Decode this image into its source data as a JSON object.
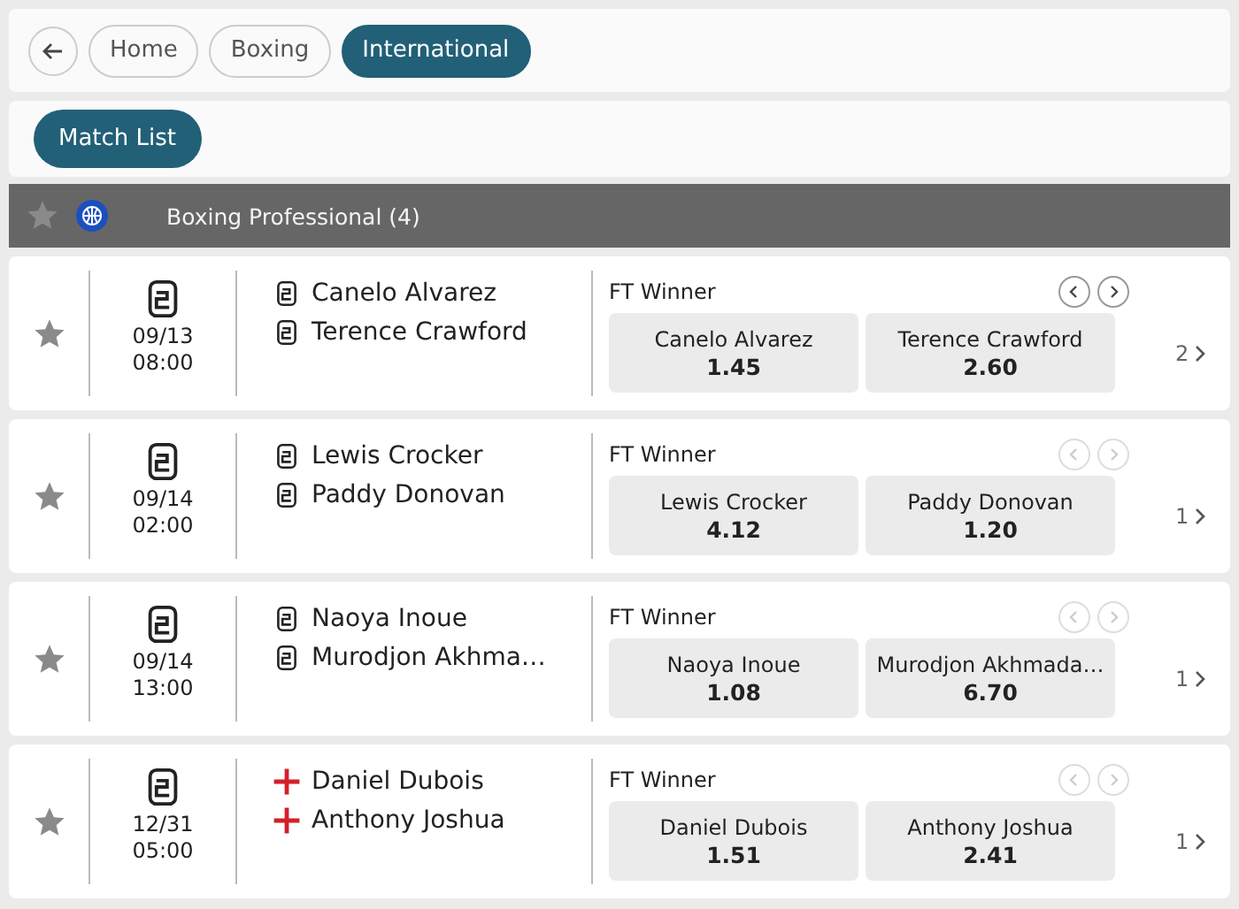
{
  "breadcrumbs": [
    {
      "label": "Home",
      "selected": false
    },
    {
      "label": "Boxing",
      "selected": false
    },
    {
      "label": "International",
      "selected": true
    }
  ],
  "match_list_button": "Match List",
  "league": {
    "name": "Boxing Professional (4)",
    "favorite": false
  },
  "matches": [
    {
      "kind": "belt",
      "favorite": false,
      "date": "09/13",
      "time": "08:00",
      "fighters": [
        "Canelo Alvarez",
        "Terence Crawford"
      ],
      "market": "FT Winner",
      "nav_enabled": true,
      "odds": [
        {
          "name": "Canelo Alvarez",
          "price": "1.45"
        },
        {
          "name": "Terence Crawford",
          "price": "2.60"
        }
      ],
      "more": "2"
    },
    {
      "kind": "belt",
      "favorite": false,
      "date": "09/14",
      "time": "02:00",
      "fighters": [
        "Lewis Crocker",
        "Paddy Donovan"
      ],
      "market": "FT Winner",
      "nav_enabled": false,
      "odds": [
        {
          "name": "Lewis Crocker",
          "price": "4.12"
        },
        {
          "name": "Paddy Donovan",
          "price": "1.20"
        }
      ],
      "more": "1"
    },
    {
      "kind": "belt",
      "favorite": false,
      "date": "09/14",
      "time": "13:00",
      "fighters": [
        "Naoya Inoue",
        "Murodjon Akhma…"
      ],
      "market": "FT Winner",
      "nav_enabled": false,
      "odds": [
        {
          "name": "Naoya Inoue",
          "price": "1.08"
        },
        {
          "name": "Murodjon Akhmada…",
          "price": "6.70"
        }
      ],
      "more": "1"
    },
    {
      "kind": "england",
      "favorite": false,
      "date": "12/31",
      "time": "05:00",
      "fighters": [
        "Daniel Dubois",
        "Anthony Joshua"
      ],
      "market": "FT Winner",
      "nav_enabled": false,
      "odds": [
        {
          "name": "Daniel Dubois",
          "price": "1.51"
        },
        {
          "name": "Anthony Joshua",
          "price": "2.41"
        }
      ],
      "more": "1"
    }
  ]
}
